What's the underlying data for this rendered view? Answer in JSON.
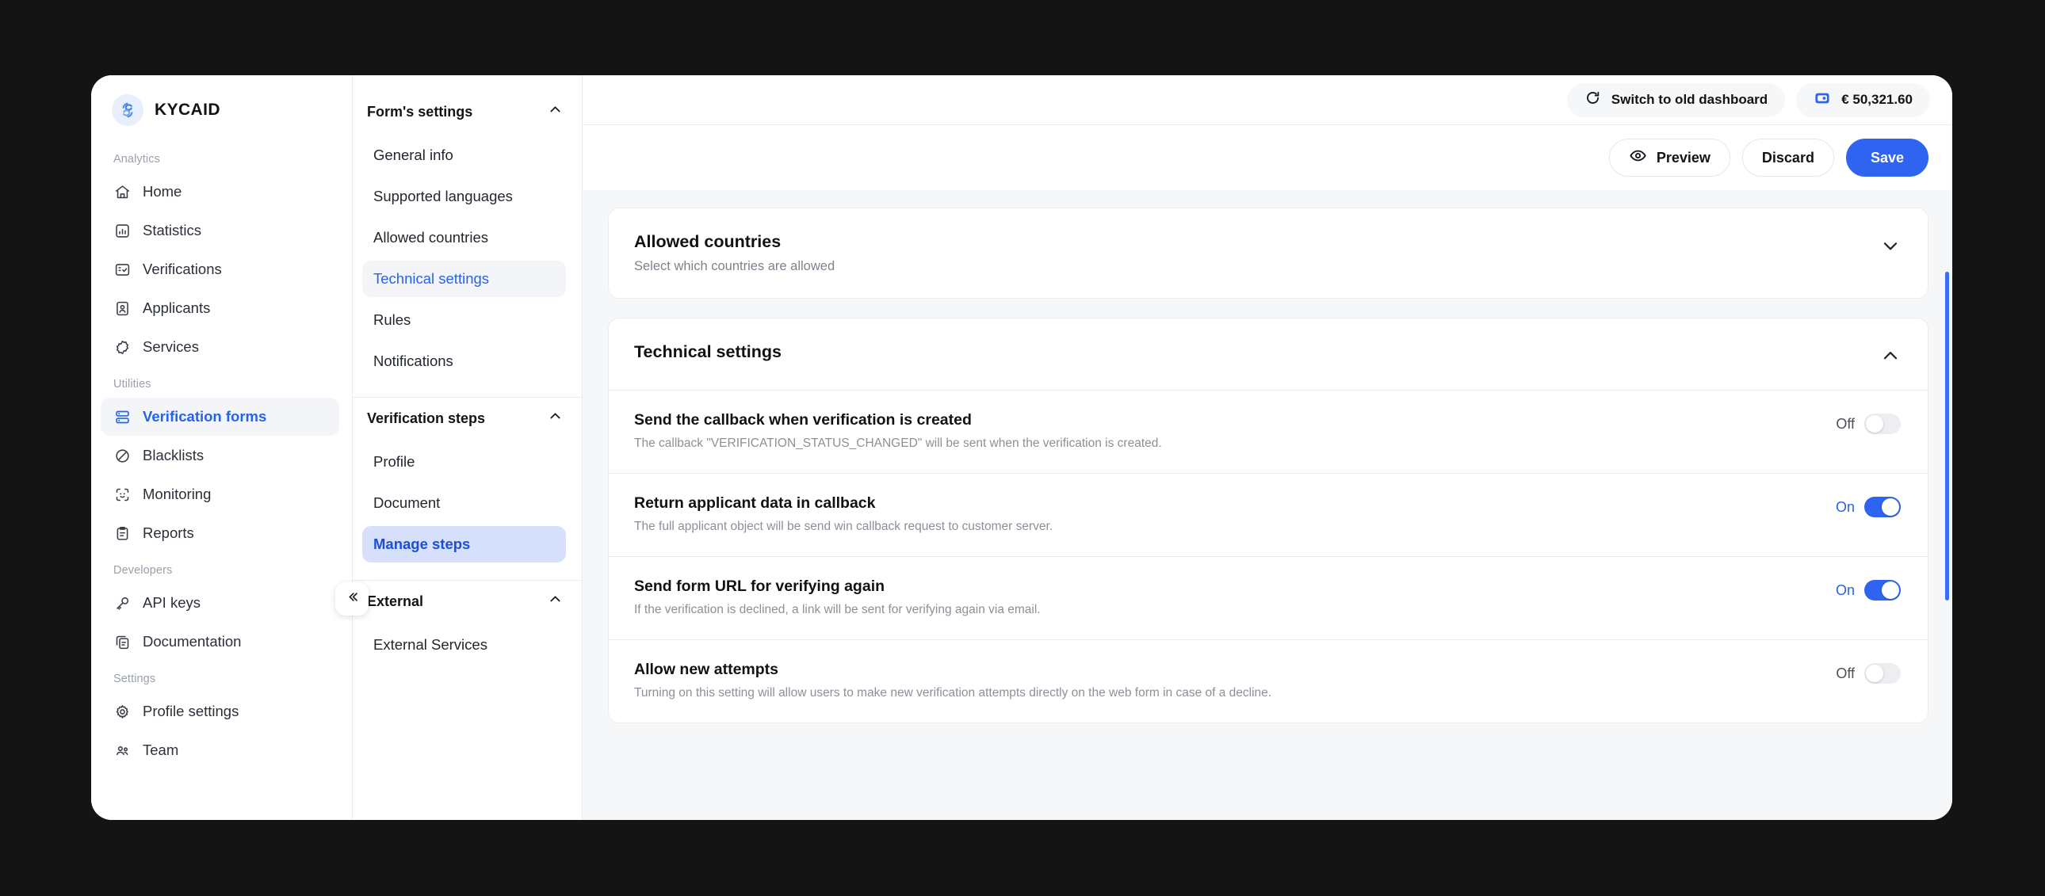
{
  "brand": {
    "name": "KYCAID",
    "logo_icon": "kycaid-swirl-icon",
    "accent": "#2f64f0"
  },
  "sidebar": {
    "groups": [
      {
        "label": "Analytics",
        "items": [
          {
            "label": "Home",
            "icon": "home-icon",
            "active": false
          },
          {
            "label": "Statistics",
            "icon": "chart-box-icon",
            "active": false
          },
          {
            "label": "Verifications",
            "icon": "checklist-box-icon",
            "active": false
          },
          {
            "label": "Applicants",
            "icon": "person-card-icon",
            "active": false
          },
          {
            "label": "Services",
            "icon": "puzzle-gear-icon",
            "active": false
          }
        ]
      },
      {
        "label": "Utilities",
        "items": [
          {
            "label": "Verification forms",
            "icon": "forms-stack-icon",
            "active": true
          },
          {
            "label": "Blacklists",
            "icon": "ban-circle-icon",
            "active": false
          },
          {
            "label": "Monitoring",
            "icon": "face-scan-icon",
            "active": false
          },
          {
            "label": "Reports",
            "icon": "clipboard-icon",
            "active": false
          }
        ]
      },
      {
        "label": "Developers",
        "items": [
          {
            "label": "API keys",
            "icon": "key-icon",
            "active": false
          },
          {
            "label": "Documentation",
            "icon": "copy-doc-icon",
            "active": false
          }
        ]
      },
      {
        "label": "Settings",
        "items": [
          {
            "label": "Profile settings",
            "icon": "gear-icon",
            "active": false
          },
          {
            "label": "Team",
            "icon": "team-icon",
            "active": false
          }
        ]
      }
    ],
    "collapse_icon": "chevron-double-left-icon"
  },
  "nav_panel": {
    "sections": [
      {
        "title": "Form's settings",
        "chevron": "chevron-up-icon",
        "items": [
          {
            "label": "General info",
            "state": "default"
          },
          {
            "label": "Supported languages",
            "state": "default"
          },
          {
            "label": "Allowed countries",
            "state": "default"
          },
          {
            "label": "Technical settings",
            "state": "active-soft"
          },
          {
            "label": "Rules",
            "state": "default"
          },
          {
            "label": "Notifications",
            "state": "default"
          }
        ]
      },
      {
        "title": "Verification steps",
        "chevron": "chevron-up-icon",
        "items": [
          {
            "label": "Profile",
            "state": "default"
          },
          {
            "label": "Document",
            "state": "default"
          },
          {
            "label": "Manage steps",
            "state": "active-strong"
          }
        ]
      },
      {
        "title": "External",
        "chevron": "chevron-up-icon",
        "items": [
          {
            "label": "External Services",
            "state": "default"
          }
        ]
      }
    ]
  },
  "topbar": {
    "switch_dashboard_label": "Switch to old dashboard",
    "switch_dashboard_icon": "refresh-icon",
    "balance": "€ 50,321.60",
    "balance_icon": "wallet-icon"
  },
  "actionbar": {
    "preview_label": "Preview",
    "preview_icon": "eye-icon",
    "discard_label": "Discard",
    "save_label": "Save"
  },
  "content": {
    "cards": [
      {
        "title": "Allowed countries",
        "subtitle": "Select which countries are allowed",
        "chevron": "chevron-down-icon",
        "expanded": false,
        "rows": []
      },
      {
        "title": "Technical settings",
        "subtitle": "",
        "chevron": "chevron-up-icon",
        "expanded": true,
        "rows": [
          {
            "title": "Send the callback when verification is created",
            "desc": "The callback \"VERIFICATION_STATUS_CHANGED\" will be sent when the verification is created.",
            "state_label": "Off",
            "on": false
          },
          {
            "title": "Return applicant data in callback",
            "desc": "The full applicant object will be send win callback request to customer server.",
            "state_label": "On",
            "on": true
          },
          {
            "title": "Send form URL for verifying again",
            "desc": "If the verification is declined, a link will be sent for verifying again via email.",
            "state_label": "On",
            "on": true
          },
          {
            "title": "Allow new attempts",
            "desc": "Turning on this setting will allow users to make new verification attempts directly on the web form in case of a decline.",
            "state_label": "Off",
            "on": false
          }
        ]
      }
    ]
  }
}
